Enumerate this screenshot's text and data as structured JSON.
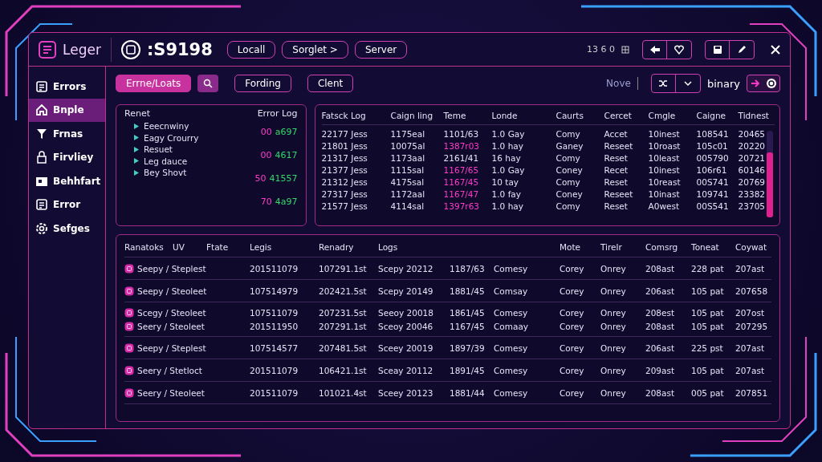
{
  "header": {
    "app_name": "Leger",
    "record_id": ":S9198",
    "buttons": [
      {
        "label": "Locall"
      },
      {
        "label": "Sorglet >"
      },
      {
        "label": "Server"
      }
    ],
    "status": "13 6 0"
  },
  "sidebar": {
    "items": [
      {
        "label": "Errors",
        "selected": false
      },
      {
        "label": "Bnple",
        "selected": true
      },
      {
        "label": "Frnas",
        "selected": false
      },
      {
        "label": "Firvliey",
        "selected": false
      },
      {
        "label": "Behhfart",
        "selected": false
      },
      {
        "label": "Error",
        "selected": false
      },
      {
        "label": "Sefges",
        "selected": false
      }
    ]
  },
  "toolbar": {
    "tabs": [
      {
        "label": "Errne/Loats",
        "selected": true
      },
      {
        "label": "Fording",
        "selected": false
      },
      {
        "label": "Clent",
        "selected": false
      }
    ],
    "view_label": "Nove",
    "mode": "binary"
  },
  "tree_panel": {
    "title": "Renet",
    "log_title": "Error Log",
    "items": [
      "Eeecnwiny",
      "Eagy Crourry",
      "Resuet",
      "Leg dauce",
      "Bey Shovt"
    ],
    "log": [
      {
        "code": "00",
        "value": "a697"
      },
      {
        "code": "00",
        "value": "4617"
      },
      {
        "code": "50",
        "value": "41557"
      },
      {
        "code": "70",
        "value": "4a97"
      }
    ]
  },
  "log_table": {
    "columns": [
      "Fatsck Log",
      "Caign ling",
      "Teme",
      "Londe",
      "Caurts",
      "Cercet",
      "Cmgle",
      "Caigne",
      "Tidnest"
    ],
    "rows": [
      {
        "highlighted": false,
        "cells": [
          "22177 Jess",
          "1175eal",
          "1101/63",
          "1.0 Gay",
          "Comy",
          "Accet",
          "10inest",
          "108541",
          "20465"
        ]
      },
      {
        "highlighted": true,
        "cells": [
          "21801 Jess",
          "10075al",
          "1387r03",
          "1.0 hay",
          "Ganey",
          "Reseet",
          "10roast",
          "105c01",
          "20220"
        ]
      },
      {
        "highlighted": false,
        "cells": [
          "21317 Jess",
          "1173aal",
          "2161/41",
          "16 hay",
          "Comy",
          "Reset",
          "10least",
          "005790",
          "20721"
        ]
      },
      {
        "highlighted": true,
        "cells": [
          "21377 Jess",
          "1115sal",
          "1167/65",
          "1.0 Gay",
          "Coney",
          "Recet",
          "10inest",
          "106r61",
          "60146"
        ]
      },
      {
        "highlighted": true,
        "cells": [
          "21312 Jess",
          "4175sal",
          "1167/45",
          "10 tay",
          "Comy",
          "Reset",
          "10reast",
          "00S741",
          "20769"
        ]
      },
      {
        "highlighted": true,
        "cells": [
          "27317 Jess",
          "1172aal",
          "1167/47",
          "1.0 fay",
          "Coney",
          "Reseet",
          "10inast",
          "109741",
          "23382"
        ]
      },
      {
        "highlighted": true,
        "cells": [
          "21577 Jess",
          "4114sal",
          "1397r63",
          "1.0 hay",
          "Comy",
          "Reset",
          "A0west",
          "00S541",
          "23705"
        ]
      }
    ]
  },
  "records_table": {
    "columns": [
      "Ranatoks",
      "UV",
      "Ftate",
      "Legis",
      "Renadry",
      "Logs",
      "Mote",
      "Tirelr",
      "Comsrg",
      "Toneat",
      "Coywat"
    ],
    "groups": [
      [
        {
          "cells": [
            "Seepy / Steplest",
            "201511079",
            "107291.1st",
            "Scepy 20212",
            "1187/63",
            "Comesy",
            "Corey",
            "Onrey",
            "208ast",
            "228 pat",
            "207ast"
          ]
        }
      ],
      [
        {
          "cells": [
            "Seepy / Steoleet",
            "107514979",
            "202421.5st",
            "Scepy 20149",
            "1881/45",
            "Comsay",
            "Corey",
            "Onrey",
            "206ast",
            "105 pat",
            "207658"
          ]
        }
      ],
      [
        {
          "cells": [
            "Scegy / Steoleet",
            "107511079",
            "207231.5st",
            "Seeoy 20018",
            "1861/45",
            "Comesy",
            "Corey",
            "Onrey",
            "208est",
            "105 pat",
            "207ost"
          ]
        },
        {
          "cells": [
            "Seery / Steoleet",
            "201511950",
            "207291.1st",
            "Sceoy 20046",
            "1167/45",
            "Comaay",
            "Corey",
            "Onrey",
            "208ast",
            "105 pat",
            "207295"
          ]
        }
      ],
      [
        {
          "cells": [
            "Seepy / Steplest",
            "107514577",
            "207481.5st",
            "Sceey 20019",
            "1897/39",
            "Comesy",
            "Corey",
            "Onrey",
            "206ast",
            "225 pst",
            "207ast"
          ]
        }
      ],
      [
        {
          "cells": [
            "Seery / Stetloct",
            "201511079",
            "106421.1st",
            "Sceay 20112",
            "1891/45",
            "Comesy",
            "Corey",
            "Onrey",
            "209ast",
            "105 pat",
            "207ast"
          ]
        }
      ],
      [
        {
          "cells": [
            "Seery / Steoleet",
            "201511079",
            "101021.4st",
            "Sceey 20123",
            "1881/44",
            "Comesy",
            "Corey",
            "Onrey",
            "208ast",
            "005 pat",
            "207851"
          ]
        }
      ]
    ]
  }
}
